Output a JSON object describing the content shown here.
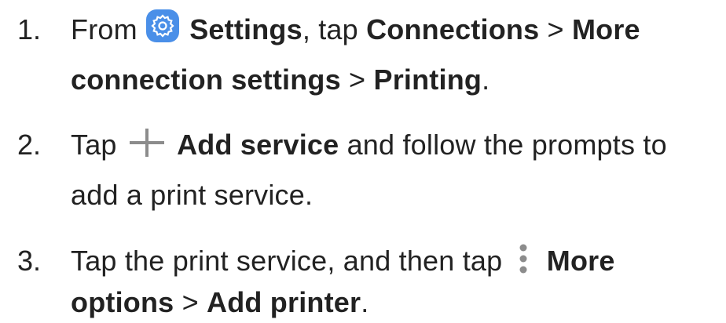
{
  "steps": [
    {
      "number": "1.",
      "line1": {
        "pre": "From",
        "icon": "settings-gear-icon",
        "bold1": "Settings",
        "mid1": ", tap ",
        "bold2": "Connections",
        "sep1": " > ",
        "bold3": "More"
      },
      "line2": {
        "bold1": "connection settings",
        "sep1": " > ",
        "bold2": "Printing",
        "end": "."
      }
    },
    {
      "number": "2.",
      "line1": {
        "pre": "Tap",
        "icon": "plus-icon",
        "bold1": "Add service",
        "post": " and follow the prompts to"
      },
      "line2": {
        "text": "add a print service."
      }
    },
    {
      "number": "3.",
      "line1": {
        "pre": "Tap the print service, and then tap",
        "icon": "more-options-icon",
        "bold1": "More"
      },
      "line2": {
        "bold1": "options",
        "sep1": " > ",
        "bold2": "Add printer",
        "end": "."
      }
    }
  ],
  "colors": {
    "text": "#222222",
    "icon_blue": "#4a8fe8",
    "icon_gray": "#8c8c8c"
  }
}
